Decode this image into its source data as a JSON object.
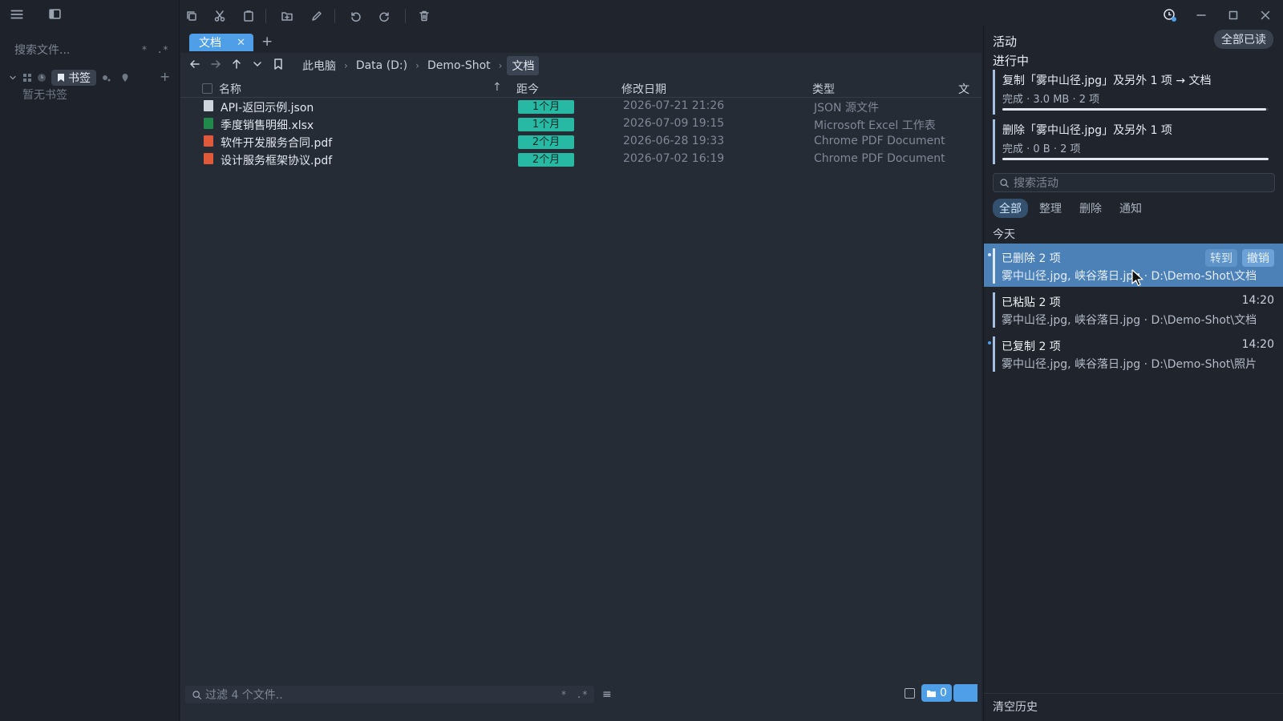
{
  "sidebar": {
    "search_placeholder": "搜索文件...",
    "search_opt_glob": "*",
    "search_opt_regex": ".*",
    "bookmarks_label": "书签",
    "add": "+",
    "empty_text": "暂无书签"
  },
  "tabs": [
    {
      "label": "文档",
      "close": "✕"
    }
  ],
  "tab_add": "+",
  "breadcrumb": [
    "此电脑",
    "Data (D:)",
    "Demo-Shot",
    "文档"
  ],
  "breadcrumb_sep": "›",
  "table": {
    "headers": {
      "name": "名称",
      "age": "距今",
      "modified": "修改日期",
      "type": "类型",
      "more": "文"
    },
    "sort_icon": "↑",
    "rows": [
      {
        "name": "API-返回示例.json",
        "age": "1个月",
        "modified": "2026-07-21 21:26",
        "type": "JSON 源文件",
        "icon": "json-file-icon",
        "color": "#cfd5dc"
      },
      {
        "name": "季度销售明细.xlsx",
        "age": "1个月",
        "modified": "2026-07-09 19:15",
        "type": "Microsoft Excel 工作表",
        "icon": "excel-file-icon",
        "color": "#1f8a4c"
      },
      {
        "name": "软件开发服务合同.pdf",
        "age": "2个月",
        "modified": "2026-06-28 19:33",
        "type": "Chrome PDF Document",
        "icon": "pdf-file-icon",
        "color": "#e05a3a"
      },
      {
        "name": "设计服务框架协议.pdf",
        "age": "2个月",
        "modified": "2026-07-02 16:19",
        "type": "Chrome PDF Document",
        "icon": "pdf-file-icon",
        "color": "#e05a3a"
      }
    ]
  },
  "status": {
    "filter_placeholder": "过滤 4 个文件..",
    "filter_opt_glob": "*",
    "filter_opt_regex": ".*",
    "list_icon": "≡",
    "folder_count": "0"
  },
  "activity": {
    "title": "活动",
    "mark_all_read": "全部已读",
    "in_progress_label": "进行中",
    "progress": [
      {
        "title": "复制「雾中山径.jpg」及另外 1 项 → 文档",
        "status": "完成 · 3.0 MB · 2 项",
        "fraction": 0.99
      },
      {
        "title": "删除「雾中山径.jpg」及另外 1 项",
        "status": "完成 · 0 B · 2 项",
        "fraction": 1.0
      }
    ],
    "search_placeholder": "搜索活动",
    "filters": [
      "全部",
      "整理",
      "删除",
      "通知"
    ],
    "today_label": "今天",
    "entries": [
      {
        "title": "已删除 2 项",
        "detail": "雾中山径.jpg, 峡谷落日.jpg · D:\\Demo-Shot\\文档",
        "goto": "转到",
        "undo": "撤销",
        "unread": true
      },
      {
        "title": "已粘贴 2 项",
        "detail": "雾中山径.jpg, 峡谷落日.jpg · D:\\Demo-Shot\\文档",
        "time": "14:20",
        "unread": false
      },
      {
        "title": "已复制 2 项",
        "detail": "雾中山径.jpg, 峡谷落日.jpg · D:\\Demo-Shot\\照片",
        "time": "14:20",
        "unread": true
      }
    ],
    "clear_history": "清空历史"
  },
  "colors": {
    "accent": "#4f9ee8",
    "age_badge": "#27b9a3",
    "selected_entry": "#4c81b8"
  }
}
